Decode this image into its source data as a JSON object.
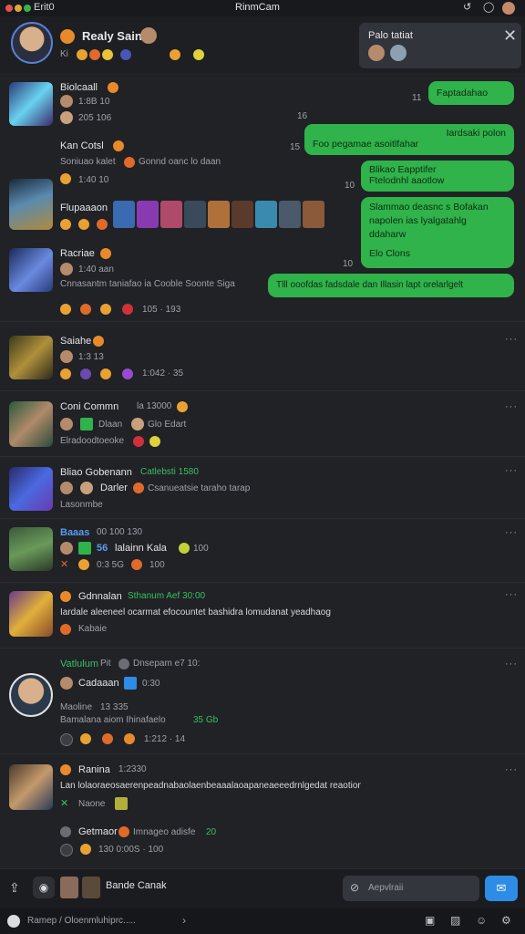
{
  "window": {
    "left_label": "Erit0",
    "title": "RinmCam"
  },
  "header": {
    "name": "Realy Sain",
    "meta": "Ki"
  },
  "popup": {
    "title": "Palo tatiat"
  },
  "right_messages": [
    {
      "text": "Faptadahao"
    },
    {
      "text": "Foo pegamae asoitlfahar"
    },
    {
      "text": "Blikao         Eapptifer"
    },
    {
      "text": "Slammao deasnc s Bofakan"
    },
    {
      "text": "Tlll ooofdas fadsdale dan Illasin lapt orelarlgelt"
    }
  ],
  "right_extra": {
    "line2": "Iardsaki polon",
    "line3": "Ftelodnhl aaotlow",
    "line4b": "napolen ias lyalgatahlg",
    "line4c": "ddaharw",
    "line4d": "Elo Clons"
  },
  "timestamps": [
    "11",
    "15",
    "10",
    "16"
  ],
  "feed": [
    {
      "name": "Biolcaall",
      "sub1": "1:8B 10",
      "sub2": "205 106"
    },
    {
      "name": "Kan Cotsl",
      "sub1": "Soniuao kalet",
      "sub1b": "Gonnd oanc lo daan",
      "sub2": "1:40 10"
    },
    {
      "name": "Flupaaaon"
    },
    {
      "name": "Racriae",
      "sub1": "1:40 aan",
      "sub2": "Cnnasantm taniafao ia Cooble Soonte Siga",
      "sub3": "105 · 193"
    },
    {
      "name": "Saiahe",
      "sub1": "1:3 13",
      "sub2": "1:042 · 35"
    },
    {
      "name": "Coni Commn",
      "name_b": "la 13000",
      "sub1": "Dlaan",
      "sub1b": "Glo Edart",
      "sub2": "Elradoodtoeoke"
    },
    {
      "name": "Bliao Gobenann",
      "name_b": "Catlebsti 1580",
      "sub1": "Darler",
      "sub1b": "Csanueatsie taraho tarap",
      "sub2": "Lasonmbe"
    },
    {
      "name": "Baaas",
      "name_b": "00 100 130",
      "sub1": "56",
      "sub1b": "lalainn Kala",
      "sub1c": "100",
      "sub2": "0:3 5G",
      "sub2b": "100"
    },
    {
      "name": "Gdnnalan",
      "name_b": "Sthanum Aef 30:00",
      "sub1": "Iardale aleeneel ocarmat efocountet bashidra lomudanat yeadhaog",
      "sub2": "Kabaie"
    },
    {
      "name": "Vatlulum",
      "name_b": "Pit",
      "name_c": "Dnsepam e7 10:",
      "sub1": "Cadaaan",
      "sub1b": "0:30",
      "sub2": "Maoline",
      "sub2b": "13 335",
      "sub3": "Bamalana aiom Ihinafaelo",
      "sub3b": "35 Gb",
      "sub4": "1:212 · 14"
    },
    {
      "name": "Ranina",
      "name_b": "1:2330",
      "sub1": "Lan lolaoraeosaerenpeadnabaolaenbeaaalaoapaneaeeedrnlgedat reaotiong",
      "sub2": "Naone",
      "sub3": "Getmaor",
      "sub3b": "Imnageo adisfe",
      "sub3c": "20",
      "sub4": "130 0:00S · 100"
    }
  ],
  "bottom": {
    "label": "Bande Canak",
    "search_placeholder": "Aepvlraii"
  },
  "status": {
    "text": "Ramep / Oloenmluhiprc....."
  },
  "colors": {
    "accent_green": "#2fb34a",
    "send_blue": "#2d8ce6",
    "bg": "#202226"
  }
}
